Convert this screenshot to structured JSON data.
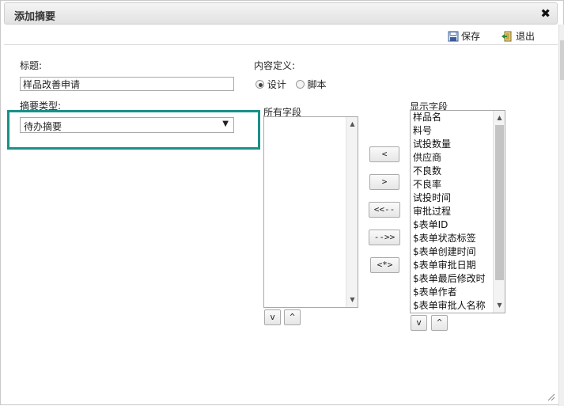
{
  "dialog": {
    "title": "添加摘要"
  },
  "toolbar": {
    "save_label": "保存",
    "exit_label": "退出"
  },
  "form": {
    "title_label": "标题:",
    "title_value": "样品改善申请",
    "type_label": "摘要类型:",
    "type_value": "待办摘要",
    "content_def_label": "内容定义:",
    "radio_design": "设计",
    "radio_script": "脚本",
    "all_fields_label": "所有字段",
    "display_fields_label": "显示字段"
  },
  "display_fields": [
    "样品名",
    "料号",
    "试投数量",
    "供应商",
    "不良数",
    "不良率",
    "试投时间",
    "审批过程",
    "$表单ID",
    "$表单状态标签",
    "$表单创建时间",
    "$表单审批日期",
    "$表单最后修改时",
    "$表单作者",
    "$表单审批人名称"
  ],
  "move_buttons": {
    "left": "<",
    "right": ">",
    "all_left": "<<--",
    "all_right": "-->>",
    "custom": "<*>"
  },
  "order_buttons": {
    "down": "v",
    "up": "^"
  },
  "accent_color": "#1a9088"
}
